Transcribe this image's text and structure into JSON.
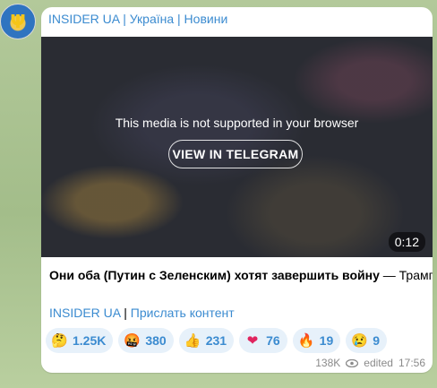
{
  "channel": {
    "name": "INSIDER UA | Україна | Новини",
    "avatar_icon": "ukraine-trident-icon"
  },
  "media": {
    "unsupported_message": "This media is not supported in your browser",
    "view_button": "VIEW IN TELEGRAM",
    "duration": "0:12"
  },
  "post": {
    "text_bold": "Они оба (Путин с Зеленским) хотят завершить войну",
    "text_rest": " — Трамп",
    "link_channel": "INSIDER UA",
    "separator": " | ",
    "link_submit": "Прислать контент"
  },
  "reactions": [
    {
      "icon": "thinking-face-icon",
      "emoji": "🤔",
      "count": "1.25K"
    },
    {
      "icon": "angry-face-icon",
      "emoji": "🤬",
      "count": "380"
    },
    {
      "icon": "thumbs-up-icon",
      "emoji": "👍",
      "count": "231"
    },
    {
      "icon": "red-heart-icon",
      "emoji": "❤",
      "count": "76"
    },
    {
      "icon": "fire-icon",
      "emoji": "🔥",
      "count": "19"
    },
    {
      "icon": "crying-face-icon",
      "emoji": "😢",
      "count": "9"
    }
  ],
  "meta": {
    "views": "138K",
    "views_icon": "eye-icon",
    "edited": "edited",
    "time": "17:56"
  },
  "colors": {
    "link": "#3b8bd0",
    "reaction_bg": "#e7f1fa",
    "background": "#a9c190"
  }
}
